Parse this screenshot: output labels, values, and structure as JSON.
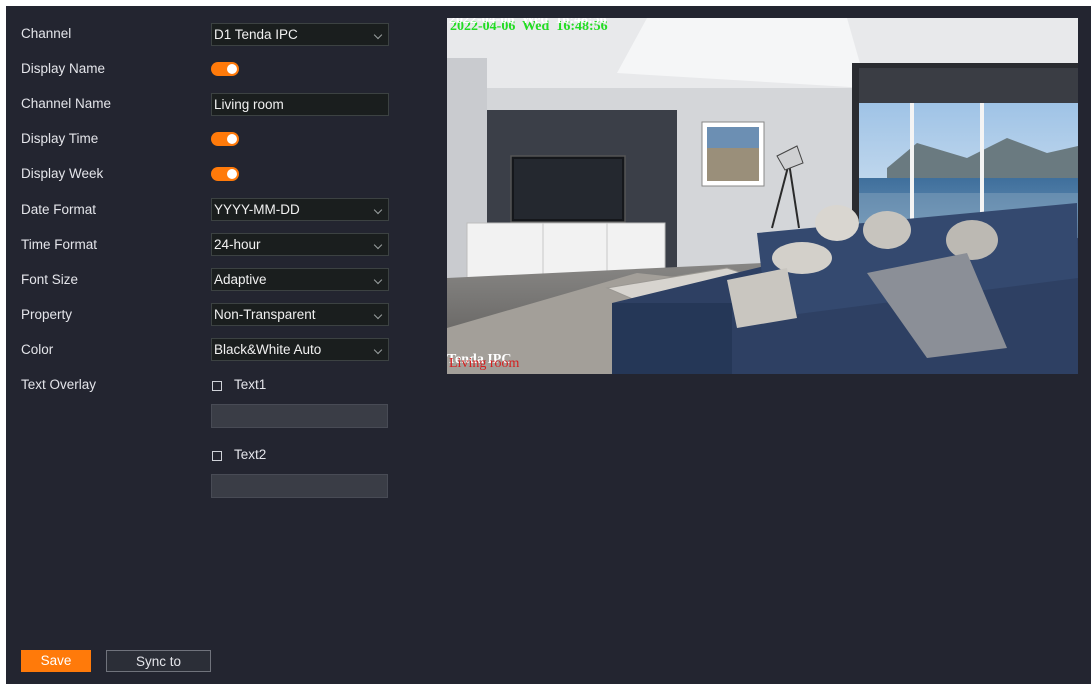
{
  "settings": {
    "channel": {
      "label": "Channel",
      "value": "D1 Tenda IPC"
    },
    "display_name": {
      "label": "Display Name",
      "enabled": true
    },
    "channel_name": {
      "label": "Channel Name",
      "value": "Living room"
    },
    "display_time": {
      "label": "Display Time",
      "enabled": true
    },
    "display_week": {
      "label": "Display Week",
      "enabled": true
    },
    "date_format": {
      "label": "Date Format",
      "value": "YYYY-MM-DD"
    },
    "time_format": {
      "label": "Time Format",
      "value": "24-hour"
    },
    "font_size": {
      "label": "Font Size",
      "value": "Adaptive"
    },
    "property": {
      "label": "Property",
      "value": "Non-Transparent"
    },
    "color": {
      "label": "Color",
      "value": "Black&White Auto"
    },
    "text_overlay": {
      "label": "Text Overlay",
      "items": [
        {
          "label": "Text1",
          "checked": false,
          "value": ""
        },
        {
          "label": "Text2",
          "checked": false,
          "value": ""
        }
      ]
    }
  },
  "preview": {
    "osd_date": "2022-04-06",
    "osd_week": "Wed",
    "osd_time": "16:48:56",
    "osd_device": "Tenda IPC",
    "osd_channel_name": "Living room",
    "osd_colors": {
      "primary": "#ffffff",
      "shadow": "#22dd22",
      "device": "#ffffff",
      "channel": "#d42020"
    }
  },
  "actions": {
    "save_label": "Save",
    "sync_label": "Sync to"
  },
  "colors": {
    "accent": "#ff7a0a",
    "panel": "#232530",
    "field_bg": "#1a1e1e"
  }
}
